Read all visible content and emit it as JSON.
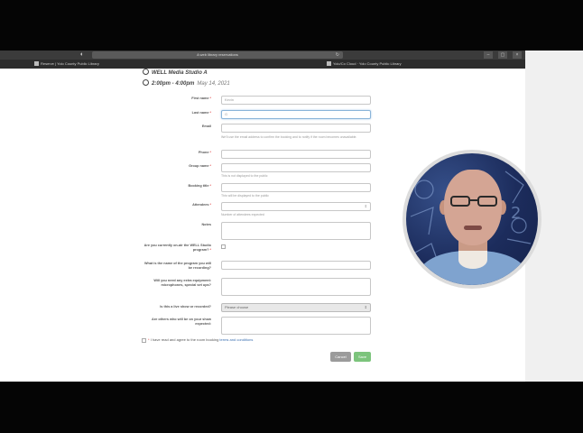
{
  "browser": {
    "url": "A web library reservations",
    "tabs": [
      {
        "label": "Reserve | Yolo County Public Library"
      },
      {
        "label": "Yolo/Co Cloud · Yolo County Public Library"
      }
    ]
  },
  "event": {
    "room": "WELL Media Studio A",
    "time": "2:00pm - 4:00pm",
    "date": "May 14, 2021"
  },
  "form": {
    "first_name": {
      "label": "First name",
      "required": "*",
      "value": "Kevin"
    },
    "last_name": {
      "label": "Last name",
      "required": "*",
      "value": "G"
    },
    "email": {
      "label": "Email",
      "help": "We'll use the email address to confirm the booking and to notify if the room becomes unavailable."
    },
    "phone": {
      "label": "Phone",
      "required": "*"
    },
    "group_name": {
      "label": "Group name",
      "required": "*",
      "help": "This is not displayed to the public"
    },
    "booking_title": {
      "label": "Booking title",
      "required": "*",
      "help": "This will be displayed to the public"
    },
    "attendees": {
      "label": "Attendees",
      "required": "*",
      "help": "Number of attendees expected"
    },
    "notes": {
      "label": "Notes"
    },
    "current_series": {
      "label": "Are you currently on-air the WELL Studio program?",
      "required": "*"
    },
    "program_name": {
      "label": "What is the name of the program you will be recording?"
    },
    "equipment": {
      "label": "Will you need any extra equipment: microphones, special set ups?"
    },
    "live_show": {
      "label": "Is this a live show or recorded?",
      "selected": "Please choose"
    },
    "other_people": {
      "label": "Are others who will be on your show expected:"
    }
  },
  "terms": {
    "text": "I have read and agree to the room booking",
    "link": "terms and conditions"
  },
  "buttons": {
    "cancel": "Cancel",
    "save": "Save"
  },
  "icons": {
    "room": "clock-icon",
    "time": "clock-icon",
    "select_caret": "updown-caret-icon",
    "number_spinner": "spinner-icon"
  }
}
